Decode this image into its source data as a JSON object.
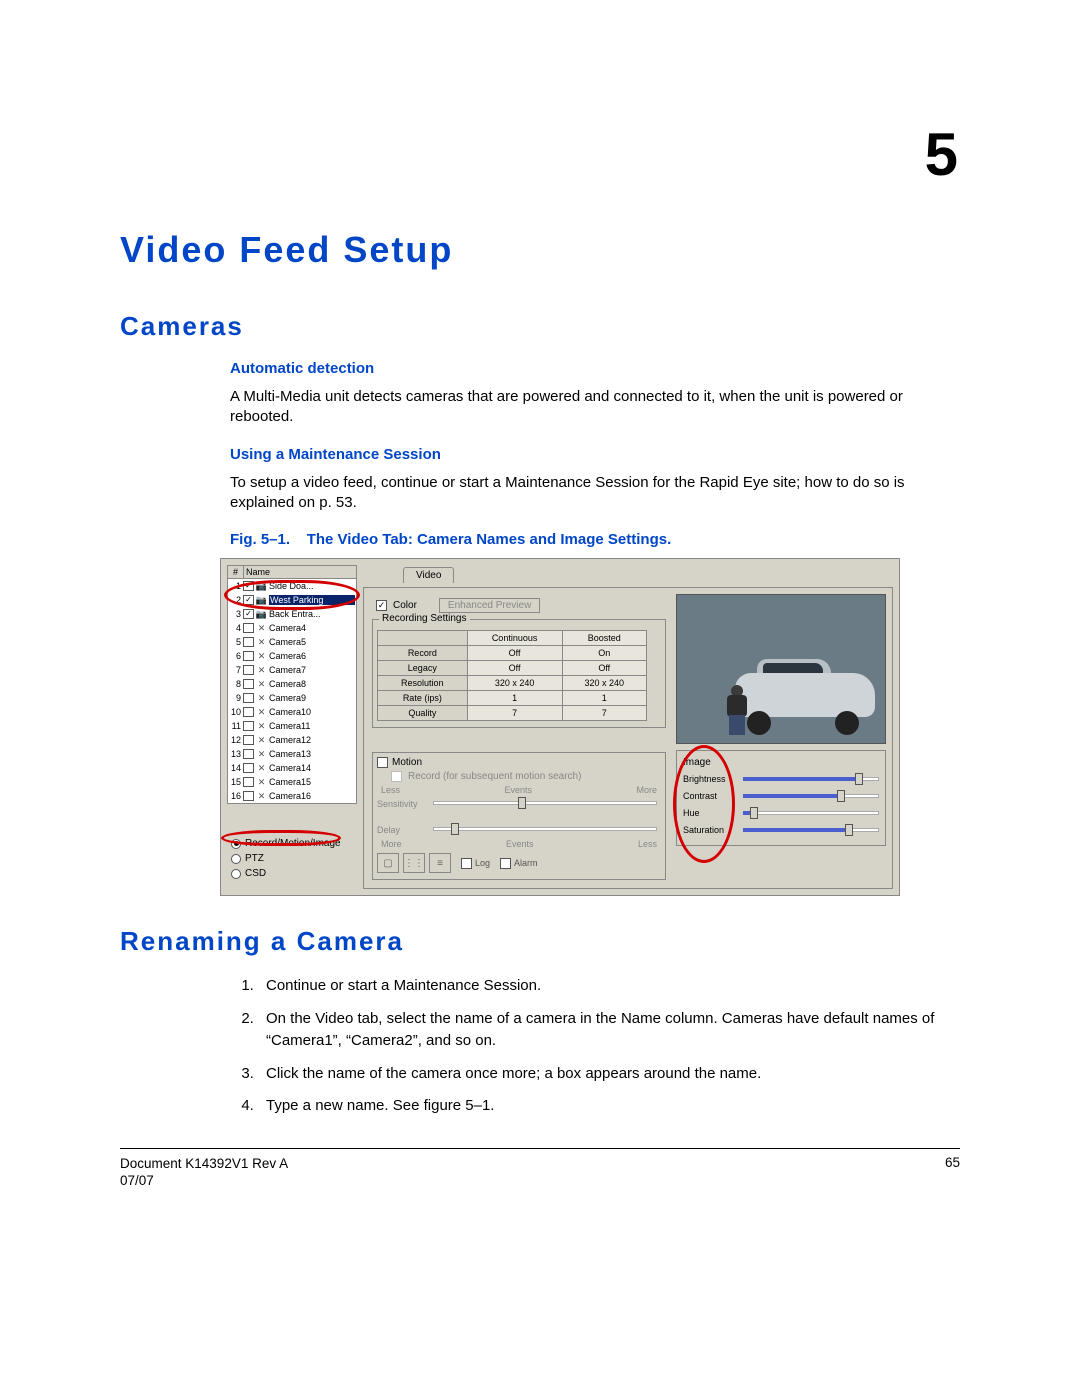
{
  "chapter_number": "5",
  "h1": "Video Feed Setup",
  "h2a": "Cameras",
  "h3a": "Automatic detection",
  "p1": "A Multi-Media unit detects cameras that are powered and connected to it, when the unit is powered or rebooted.",
  "h3b": "Using a Maintenance Session",
  "p2": "To setup a video feed, continue or start a Maintenance Session for the Rapid Eye site; how to do so is explained on p. 53.",
  "fig_label_prefix": "Fig. 5–1.",
  "fig_label_text": "The Video Tab: Camera Names and Image Settings.",
  "ui": {
    "list_head_num": "#",
    "list_head_name": "Name",
    "cameras": [
      {
        "n": "1",
        "checked": true,
        "icon": "cam",
        "label": "Side Doa..."
      },
      {
        "n": "2",
        "checked": true,
        "icon": "cam",
        "label": "West Parking",
        "selected": true
      },
      {
        "n": "3",
        "checked": true,
        "icon": "cam",
        "label": "Back Entra..."
      },
      {
        "n": "4",
        "checked": false,
        "icon": "x",
        "label": "Camera4"
      },
      {
        "n": "5",
        "checked": false,
        "icon": "x",
        "label": "Camera5"
      },
      {
        "n": "6",
        "checked": false,
        "icon": "x",
        "label": "Camera6"
      },
      {
        "n": "7",
        "checked": false,
        "icon": "x",
        "label": "Camera7"
      },
      {
        "n": "8",
        "checked": false,
        "icon": "x",
        "label": "Camera8"
      },
      {
        "n": "9",
        "checked": false,
        "icon": "x",
        "label": "Camera9"
      },
      {
        "n": "10",
        "checked": false,
        "icon": "x",
        "label": "Camera10"
      },
      {
        "n": "11",
        "checked": false,
        "icon": "x",
        "label": "Camera11"
      },
      {
        "n": "12",
        "checked": false,
        "icon": "x",
        "label": "Camera12"
      },
      {
        "n": "13",
        "checked": false,
        "icon": "x",
        "label": "Camera13"
      },
      {
        "n": "14",
        "checked": false,
        "icon": "x",
        "label": "Camera14"
      },
      {
        "n": "15",
        "checked": false,
        "icon": "x",
        "label": "Camera15"
      },
      {
        "n": "16",
        "checked": false,
        "icon": "x",
        "label": "Camera16"
      }
    ],
    "radio1": "Record/Motion/Image",
    "radio2": "PTZ",
    "radio3": "CSD",
    "tab_video": "Video",
    "color_label": "Color",
    "enhanced_btn": "Enhanced Preview",
    "rec_legend": "Recording Settings",
    "rec_cols": [
      "",
      "Continuous",
      "Boosted"
    ],
    "rec_rows": [
      {
        "h": "Record",
        "a": "Off",
        "b": "On"
      },
      {
        "h": "Legacy",
        "a": "Off",
        "b": "Off"
      },
      {
        "h": "Resolution",
        "a": "320 x 240",
        "b": "320 x 240"
      },
      {
        "h": "Rate (ips)",
        "a": "1",
        "b": "1"
      },
      {
        "h": "Quality",
        "a": "7",
        "b": "7"
      }
    ],
    "motion_label": "Motion",
    "motion_sub": "Record (for subsequent motion search)",
    "sens_less": "Less",
    "sens_events": "Events",
    "sens_more": "More",
    "sensitivity": "Sensitivity",
    "delay_label": "Delay",
    "delay_more": "More",
    "delay_events": "Events",
    "delay_less": "Less",
    "log_label": "Log",
    "alarm_label": "Alarm",
    "image_legend": "Image",
    "sliders": [
      {
        "label": "Brightness",
        "pct": 85
      },
      {
        "label": "Contrast",
        "pct": 72
      },
      {
        "label": "Hue",
        "pct": 8
      },
      {
        "label": "Saturation",
        "pct": 78
      }
    ]
  },
  "h2b": "Renaming a Camera",
  "steps": [
    "Continue or start a Maintenance Session.",
    "On the Video tab, select the name of a camera in the Name column. Cameras have default names of “Camera1”, “Camera2”, and so on.",
    "Click the name of the camera once more; a box appears around the name.",
    "Type a new name. See figure 5–1."
  ],
  "footer": {
    "doc": "Document K14392V1 Rev A",
    "date": "07/07",
    "page": "65"
  }
}
